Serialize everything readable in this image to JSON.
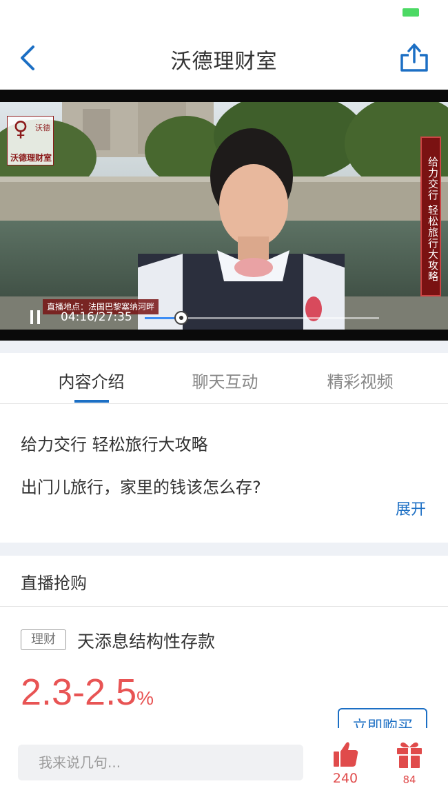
{
  "nav": {
    "title": "沃德理财室"
  },
  "video": {
    "logo_small": "沃德",
    "logo_text": "沃德理财室",
    "side_banner": "给力交行 轻松旅行大攻略",
    "location_caption": "直播地点：法国巴黎塞纳河畔",
    "time": "04:16/27:35",
    "progress": 0.155
  },
  "tabs": [
    {
      "label": "内容介绍",
      "active": true
    },
    {
      "label": "聊天互动",
      "active": false
    },
    {
      "label": "精彩视频",
      "active": false
    }
  ],
  "intro": {
    "title": "给力交行 轻松旅行大攻略",
    "description": "出门儿旅行，家里的钱该怎么存?",
    "expand": "展开"
  },
  "purchase": {
    "title": "直播抢购",
    "product_tag": "理财",
    "product_name": "天添息结构性存款",
    "rate": "2.3-2.5",
    "rate_unit": "%",
    "buy_label": "立即购买"
  },
  "bottom": {
    "comment_placeholder": "我来说几句...",
    "like_count": "240",
    "gift_count": "84"
  },
  "colors": {
    "accent": "#1c6fc4",
    "rate": "#e85454",
    "icon_red": "#e04b4b",
    "battery": "#4cd964"
  },
  "icons": {
    "back": "chevron-left-icon",
    "share": "share-icon",
    "pause": "pause-icon",
    "like": "thumbs-up-icon",
    "gift": "gift-icon"
  }
}
